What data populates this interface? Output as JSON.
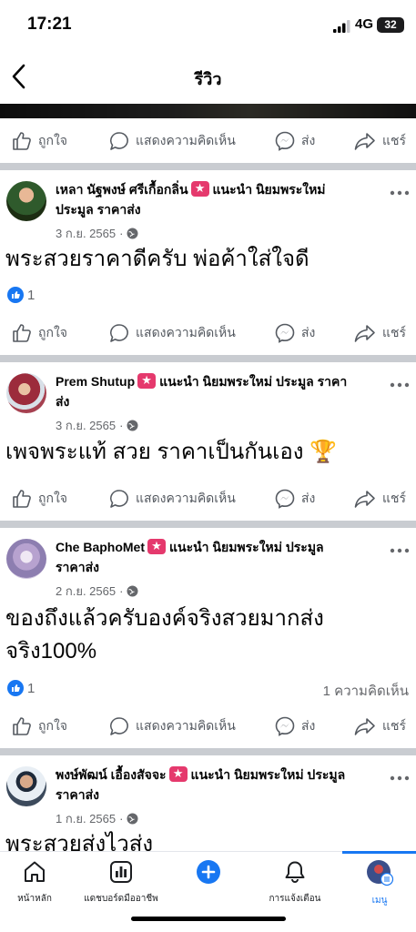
{
  "status": {
    "time": "17:21",
    "network": "4G",
    "battery": "32"
  },
  "nav": {
    "title": "รีวิว"
  },
  "actions": {
    "like": "ถูกใจ",
    "comment": "แสดงความคิดเห็น",
    "send": "ส่ง",
    "share": "แชร์"
  },
  "posts": [
    {
      "author": "เหลา นัฐพงษ์ ศรีเกื้อกลิ่น",
      "role": "แนะนำ นิยมพระใหม่ ประมูล ราคาส่ง",
      "date": "3 ก.ย. 2565",
      "text": "พระสวยราคาดีครับ พ่อค้าใส่ใจดี",
      "likes": "1",
      "comments": ""
    },
    {
      "author": "Prem Shutup",
      "role": "แนะนำ นิยมพระใหม่ ประมูล ราคาส่ง",
      "date": "3 ก.ย. 2565",
      "text": "เพจพระแท้ สวย ราคาเป็นกันเอง 🏆",
      "likes": "",
      "comments": ""
    },
    {
      "author": "Che BaphoMet",
      "role": "แนะนำ นิยมพระใหม่ ประมูล ราคาส่ง",
      "date": "2 ก.ย. 2565",
      "text": "ของถึงแล้วครับองค์จริงสวยมากส่งจริง100%",
      "likes": "1",
      "comments": "1 ความคิดเห็น"
    },
    {
      "author": "พงษ์พัฒน์ เอื้องสัจจะ",
      "role": "แนะนำ นิยมพระใหม่ ประมูล ราคาส่ง",
      "date": "1 ก.ย. 2565",
      "text": "พระสวยส่งไวส่ง",
      "likes": "",
      "comments": ""
    }
  ],
  "tabs": [
    {
      "label": "หน้าหลัก",
      "icon": "home-icon"
    },
    {
      "label": "แดชบอร์ดมืออาชีพ",
      "icon": "dashboard-icon"
    },
    {
      "label": "",
      "icon": "add-icon"
    },
    {
      "label": "การแจ้งเตือน",
      "icon": "bell-icon"
    },
    {
      "label": "เมนู",
      "icon": "menu-avatar-icon"
    }
  ],
  "colors": {
    "accent": "#1877f2",
    "badge": "#e5396d",
    "separator": "#c9ccd1",
    "muted": "#65676b"
  }
}
